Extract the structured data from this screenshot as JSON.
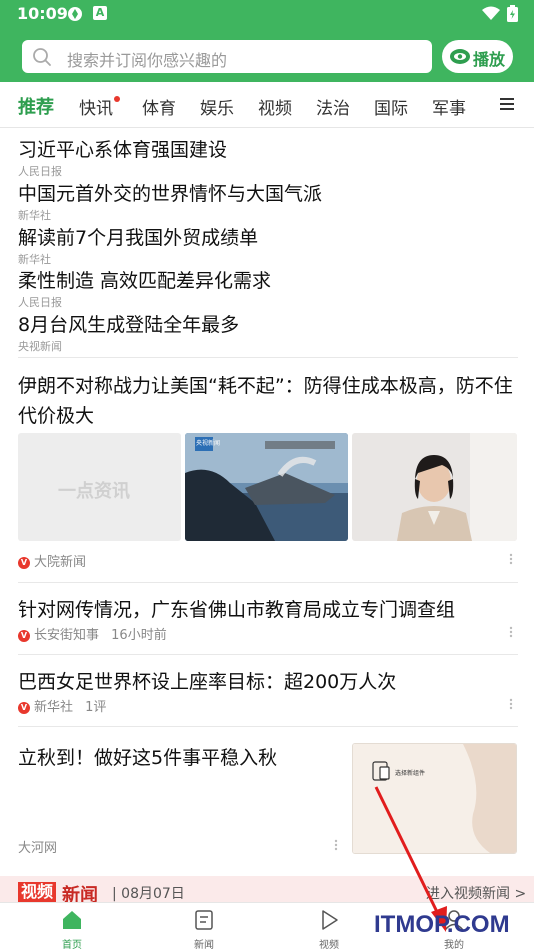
{
  "status": {
    "time": "10:09"
  },
  "search": {
    "placeholder": "搜索并订阅你感兴趣的",
    "play_label": "播放"
  },
  "tabs": [
    {
      "label": "推荐"
    },
    {
      "label": "快讯"
    },
    {
      "label": "体育"
    },
    {
      "label": "娱乐"
    },
    {
      "label": "视频"
    },
    {
      "label": "法治"
    },
    {
      "label": "国际"
    },
    {
      "label": "军事"
    }
  ],
  "headlines": [
    {
      "title": "习近平心系体育强国建设",
      "source": "人民日报"
    },
    {
      "title": "中国元首外交的世界情怀与大国气派",
      "source": "新华社"
    },
    {
      "title": "解读前7个月我国外贸成绩单",
      "source": "新华社"
    },
    {
      "title": "柔性制造 高效匹配差异化需求",
      "source": "人民日报"
    },
    {
      "title": "8月台风生成登陆全年最多",
      "source": "央视新闻"
    }
  ],
  "feed": {
    "article1": {
      "title": "伊朗不对称战力让美国“耗不起”：防得住成本极高，防不住代价极大",
      "source": "大院新闻",
      "thumb1_text": "一点资讯",
      "thumb2_badge": "央视新闻"
    },
    "article2": {
      "title": "针对网传情况，广东省佛山市教育局成立专门调查组",
      "source": "长安街知事",
      "time": "16小时前"
    },
    "article3": {
      "title": "巴西女足世界杯设上座率目标：超200万人次",
      "source": "新华社",
      "comments": "1评"
    },
    "article4": {
      "title": "立秋到！做好这5件事平稳入秋",
      "source": "大河网",
      "thumb_caption": "选择新组件"
    }
  },
  "banner": {
    "badge": "视频",
    "title": "新闻",
    "date": "| 08月07日",
    "right": "进入视频新闻 >"
  },
  "bottom_nav": [
    {
      "label": "首页"
    },
    {
      "label": "新闻"
    },
    {
      "label": "视频"
    },
    {
      "label": "我的"
    }
  ],
  "watermark": "ITMOP.COM",
  "colors": {
    "brand_green": "#3fb55f",
    "accent_red": "#e8382d"
  }
}
